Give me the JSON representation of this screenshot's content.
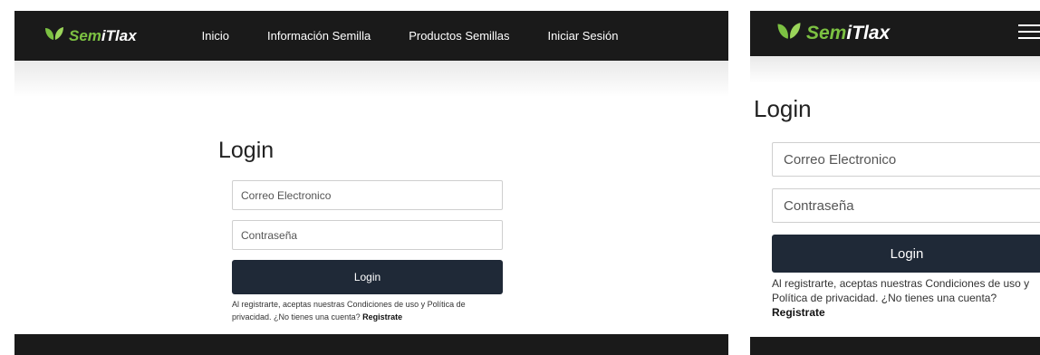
{
  "brand": {
    "prefix": "Sem",
    "rest": "iTlax"
  },
  "nav": {
    "items": [
      "Inicio",
      "Información Semilla",
      "Productos Semillas",
      "Iniciar Sesión"
    ]
  },
  "login": {
    "title": "Login",
    "email_placeholder": "Correo Electronico",
    "password_placeholder": "Contraseña",
    "button_label": "Login",
    "terms_text": "Al registrarte, aceptas nuestras Condiciones de uso y Política de privacidad. ¿No tienes una cuenta?",
    "register_link": "Registrate"
  },
  "colors": {
    "navbar": "#1a1a1a",
    "brand_accent": "#7cc142",
    "button": "#1f2937"
  },
  "icons": {
    "logo": "leaf-logo-icon",
    "menu": "hamburger-menu-icon"
  }
}
